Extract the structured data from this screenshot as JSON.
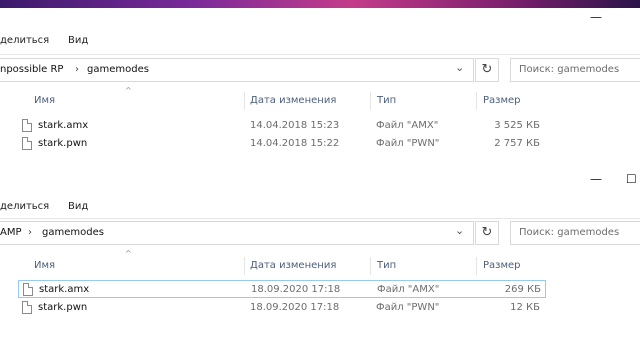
{
  "window1": {
    "menu": {
      "share": "делиться",
      "view": "Вид"
    },
    "address": {
      "parent": "npossible RP",
      "current": "gamemodes"
    },
    "search": {
      "placeholder": "Поиск: gamemodes"
    },
    "columns": {
      "name": "Имя",
      "date": "Дата изменения",
      "type": "Тип",
      "size": "Размер"
    },
    "files": [
      {
        "name": "stark.amx",
        "date": "14.04.2018 15:23",
        "type": "Файл \"AMX\"",
        "size": "3 525 КБ"
      },
      {
        "name": "stark.pwn",
        "date": "14.04.2018 15:22",
        "type": "Файл \"PWN\"",
        "size": "2 757 КБ"
      }
    ]
  },
  "window2": {
    "menu": {
      "share": "делиться",
      "view": "Вид"
    },
    "address": {
      "parent": "AMP",
      "current": "gamemodes"
    },
    "search": {
      "placeholder": "Поиск: gamemodes"
    },
    "columns": {
      "name": "Имя",
      "date": "Дата изменения",
      "type": "Тип",
      "size": "Размер"
    },
    "files": [
      {
        "name": "stark.amx",
        "date": "18.09.2020 17:18",
        "type": "Файл \"AMX\"",
        "size": "269 КБ"
      },
      {
        "name": "stark.pwn",
        "date": "18.09.2020 17:18",
        "type": "Файл \"PWN\"",
        "size": "12 КБ"
      }
    ]
  },
  "glyphs": {
    "minimize": "—",
    "maximize": "☐",
    "chevron": "›",
    "dropdown": "⌄",
    "refresh": "↻",
    "sort_up": "^"
  }
}
